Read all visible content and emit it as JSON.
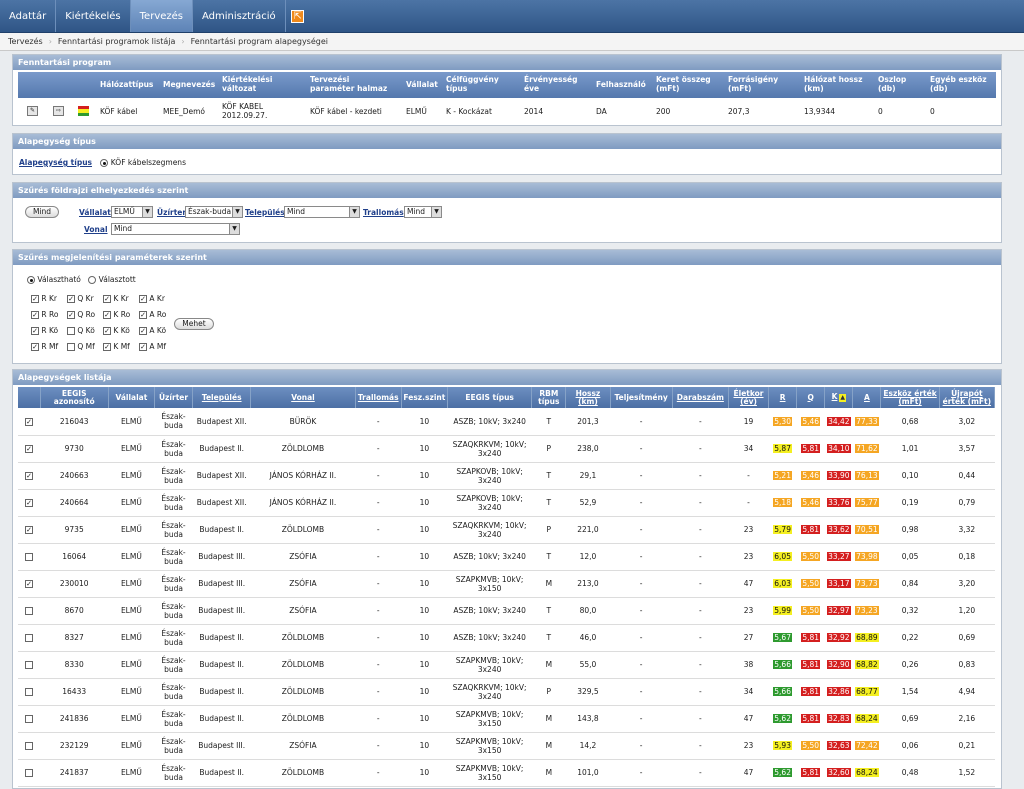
{
  "topnav": {
    "items": [
      {
        "label": "Adattár",
        "active": false
      },
      {
        "label": "Kiértékelés",
        "active": false
      },
      {
        "label": "Tervezés",
        "active": true
      },
      {
        "label": "Adminisztráció",
        "active": false
      }
    ]
  },
  "breadcrumb": [
    "Tervezés",
    "Fenntartási programok listája",
    "Fenntartási program alapegységei"
  ],
  "program": {
    "title": "Fenntartási program",
    "headers": [
      "Hálózattípus",
      "Megnevezés",
      "Kiértékelési változat",
      "Tervezési paraméter halmaz",
      "Vállalat",
      "Célfüggvény típus",
      "Érvényesség éve",
      "Felhasználó",
      "Keret összeg (mFt)",
      "Forrásigény (mFt)",
      "Hálózat hossz (km)",
      "Oszlop (db)",
      "Egyéb eszköz (db)"
    ],
    "values": [
      "KÖF kábel",
      "MEE_Demó",
      "KÖF KABEL 2012.09.27.",
      "KÖF kábel - kezdeti",
      "ELMŰ",
      "K - Kockázat",
      "2014",
      "DA",
      "200",
      "207,3",
      "13,9344",
      "0",
      "0"
    ]
  },
  "unit_type": {
    "title": "Alapegység típus",
    "label": "Alapegység típus",
    "option": "KÖF kábelszegmens"
  },
  "geo_filter": {
    "title": "Szűrés földrajzi elhelyezkedés szerint",
    "all_button": "Mind",
    "company_label": "Vállalat",
    "company_value": "ELMŰ",
    "region_label": "Üzírter",
    "region_value": "Észak-buda",
    "settlement_label": "Település",
    "settlement_value": "Mind",
    "route_label": "Trallomás",
    "route_value": "Mind",
    "line_label": "Vonal",
    "line_value": "Mind"
  },
  "param_filter": {
    "title": "Szűrés megjelenítési paraméterek szerint",
    "radio_selectable": "Választható",
    "radio_selected": "Választott",
    "checkboxes": [
      [
        {
          "label": "R Kr",
          "checked": true
        },
        {
          "label": "Q Kr",
          "checked": true
        },
        {
          "label": "K Kr",
          "checked": true
        },
        {
          "label": "A Kr",
          "checked": true
        }
      ],
      [
        {
          "label": "R Ro",
          "checked": true
        },
        {
          "label": "Q Ro",
          "checked": true
        },
        {
          "label": "K Ro",
          "checked": true
        },
        {
          "label": "A Ro",
          "checked": true
        }
      ],
      [
        {
          "label": "R Kö",
          "checked": true
        },
        {
          "label": "Q Kö",
          "checked": false
        },
        {
          "label": "K Kö",
          "checked": true
        },
        {
          "label": "A Kö",
          "checked": true
        }
      ],
      [
        {
          "label": "R Mf",
          "checked": true
        },
        {
          "label": "Q Mf",
          "checked": false
        },
        {
          "label": "K Mf",
          "checked": true
        },
        {
          "label": "A Mf",
          "checked": true
        }
      ]
    ],
    "go_button": "Mehet"
  },
  "list": {
    "title": "Alapegységek listája",
    "columns": [
      "",
      "EEGIS azonosító",
      "Vállalat",
      "Üzírter",
      "Település",
      "Vonal",
      "Trallomás",
      "Fesz.szint",
      "EEGIS típus",
      "RBM típus",
      "Hossz (km)",
      "Teljesítmény",
      "Darabszám",
      "Életkor (év)",
      "R",
      "Q",
      "K",
      "A",
      "Eszköz érték (mFt)",
      "Újrapót érték (mFt)"
    ],
    "rows": [
      {
        "checked": true,
        "id": "216043",
        "company": "ELMŰ",
        "region": "Észak-buda",
        "settlement": "Budapest XII.",
        "line": "BÜRÖK",
        "station": "-",
        "voltage": "10",
        "type": "ASZB; 10kV; 3x240",
        "rbm": "T",
        "length": "201,3",
        "power": "-",
        "count": "-",
        "age": "19",
        "r": "5,30",
        "rc": "orange",
        "q": "5,46",
        "qc": "orange",
        "k": "34,42",
        "kc": "red",
        "a": "77,33",
        "ac": "orange",
        "asset": "0,68",
        "replace": "3,02"
      },
      {
        "checked": true,
        "id": "9730",
        "company": "ELMŰ",
        "region": "Észak-buda",
        "settlement": "Budapest II.",
        "line": "ZÖLDLOMB",
        "station": "-",
        "voltage": "10",
        "type": "SZAQKRKVM; 10kV; 3x240",
        "rbm": "P",
        "length": "238,0",
        "power": "-",
        "count": "-",
        "age": "34",
        "r": "5,87",
        "rc": "yellow",
        "q": "5,81",
        "qc": "red",
        "k": "34,10",
        "kc": "red",
        "a": "71,62",
        "ac": "orange",
        "asset": "1,01",
        "replace": "3,57"
      },
      {
        "checked": true,
        "id": "240663",
        "company": "ELMŰ",
        "region": "Észak-buda",
        "settlement": "Budapest XII.",
        "line": "JÁNOS KÓRHÁZ II.",
        "station": "-",
        "voltage": "10",
        "type": "SZAPKOVB; 10kV; 3x240",
        "rbm": "T",
        "length": "29,1",
        "power": "-",
        "count": "-",
        "age": "-",
        "r": "5,21",
        "rc": "orange",
        "q": "5,46",
        "qc": "orange",
        "k": "33,90",
        "kc": "red",
        "a": "76,13",
        "ac": "orange",
        "asset": "0,10",
        "replace": "0,44"
      },
      {
        "checked": true,
        "id": "240664",
        "company": "ELMŰ",
        "region": "Észak-buda",
        "settlement": "Budapest XII.",
        "line": "JÁNOS KÓRHÁZ II.",
        "station": "-",
        "voltage": "10",
        "type": "SZAPKOVB; 10kV; 3x240",
        "rbm": "T",
        "length": "52,9",
        "power": "-",
        "count": "-",
        "age": "-",
        "r": "5,18",
        "rc": "orange",
        "q": "5,46",
        "qc": "orange",
        "k": "33,76",
        "kc": "red",
        "a": "75,77",
        "ac": "orange",
        "asset": "0,19",
        "replace": "0,79"
      },
      {
        "checked": true,
        "id": "9735",
        "company": "ELMŰ",
        "region": "Észak-buda",
        "settlement": "Budapest II.",
        "line": "ZÖLDLOMB",
        "station": "-",
        "voltage": "10",
        "type": "SZAQKRKVM; 10kV; 3x240",
        "rbm": "P",
        "length": "221,0",
        "power": "-",
        "count": "-",
        "age": "23",
        "r": "5,79",
        "rc": "yellow",
        "q": "5,81",
        "qc": "red",
        "k": "33,62",
        "kc": "red",
        "a": "70,51",
        "ac": "orange",
        "asset": "0,98",
        "replace": "3,32"
      },
      {
        "checked": false,
        "id": "16064",
        "company": "ELMŰ",
        "region": "Észak-buda",
        "settlement": "Budapest III.",
        "line": "ZSÓFIA",
        "station": "-",
        "voltage": "10",
        "type": "ASZB; 10kV; 3x240",
        "rbm": "T",
        "length": "12,0",
        "power": "-",
        "count": "-",
        "age": "23",
        "r": "6,05",
        "rc": "yellow",
        "q": "5,50",
        "qc": "orange",
        "k": "33,27",
        "kc": "red",
        "a": "73,98",
        "ac": "orange",
        "asset": "0,05",
        "replace": "0,18"
      },
      {
        "checked": true,
        "id": "230010",
        "company": "ELMŰ",
        "region": "Észak-buda",
        "settlement": "Budapest III.",
        "line": "ZSÓFIA",
        "station": "-",
        "voltage": "10",
        "type": "SZAPKMVB; 10kV; 3x150",
        "rbm": "M",
        "length": "213,0",
        "power": "-",
        "count": "-",
        "age": "47",
        "r": "6,03",
        "rc": "yellow",
        "q": "5,50",
        "qc": "orange",
        "k": "33,17",
        "kc": "red",
        "a": "73,73",
        "ac": "orange",
        "asset": "0,84",
        "replace": "3,20"
      },
      {
        "checked": false,
        "id": "8670",
        "company": "ELMŰ",
        "region": "Észak-buda",
        "settlement": "Budapest III.",
        "line": "ZSÓFIA",
        "station": "-",
        "voltage": "10",
        "type": "ASZB; 10kV; 3x240",
        "rbm": "T",
        "length": "80,0",
        "power": "-",
        "count": "-",
        "age": "23",
        "r": "5,99",
        "rc": "yellow",
        "q": "5,50",
        "qc": "orange",
        "k": "32,97",
        "kc": "red",
        "a": "73,23",
        "ac": "orange",
        "asset": "0,32",
        "replace": "1,20"
      },
      {
        "checked": false,
        "id": "8327",
        "company": "ELMŰ",
        "region": "Észak-buda",
        "settlement": "Budapest II.",
        "line": "ZÖLDLOMB",
        "station": "-",
        "voltage": "10",
        "type": "ASZB; 10kV; 3x240",
        "rbm": "T",
        "length": "46,0",
        "power": "-",
        "count": "-",
        "age": "27",
        "r": "5,67",
        "rc": "green",
        "q": "5,81",
        "qc": "red",
        "k": "32,92",
        "kc": "red",
        "a": "68,89",
        "ac": "yellow",
        "asset": "0,22",
        "replace": "0,69"
      },
      {
        "checked": false,
        "id": "8330",
        "company": "ELMŰ",
        "region": "Észak-buda",
        "settlement": "Budapest II.",
        "line": "ZÖLDLOMB",
        "station": "-",
        "voltage": "10",
        "type": "SZAPKMVB; 10kV; 3x240",
        "rbm": "M",
        "length": "55,0",
        "power": "-",
        "count": "-",
        "age": "38",
        "r": "5,66",
        "rc": "green",
        "q": "5,81",
        "qc": "red",
        "k": "32,90",
        "kc": "red",
        "a": "68,82",
        "ac": "yellow",
        "asset": "0,26",
        "replace": "0,83"
      },
      {
        "checked": false,
        "id": "16433",
        "company": "ELMŰ",
        "region": "Észak-buda",
        "settlement": "Budapest II.",
        "line": "ZÖLDLOMB",
        "station": "-",
        "voltage": "10",
        "type": "SZAQKRKVM; 10kV; 3x240",
        "rbm": "P",
        "length": "329,5",
        "power": "-",
        "count": "-",
        "age": "34",
        "r": "5,66",
        "rc": "green",
        "q": "5,81",
        "qc": "red",
        "k": "32,86",
        "kc": "red",
        "a": "68,77",
        "ac": "yellow",
        "asset": "1,54",
        "replace": "4,94"
      },
      {
        "checked": false,
        "id": "241836",
        "company": "ELMŰ",
        "region": "Észak-buda",
        "settlement": "Budapest II.",
        "line": "ZÖLDLOMB",
        "station": "-",
        "voltage": "10",
        "type": "SZAPKMVB; 10kV; 3x150",
        "rbm": "M",
        "length": "143,8",
        "power": "-",
        "count": "-",
        "age": "47",
        "r": "5,62",
        "rc": "green",
        "q": "5,81",
        "qc": "red",
        "k": "32,83",
        "kc": "red",
        "a": "68,24",
        "ac": "yellow",
        "asset": "0,69",
        "replace": "2,16"
      },
      {
        "checked": false,
        "id": "232129",
        "company": "ELMŰ",
        "region": "Észak-buda",
        "settlement": "Budapest III.",
        "line": "ZSÓFIA",
        "station": "-",
        "voltage": "10",
        "type": "SZAPKMVB; 10kV; 3x150",
        "rbm": "M",
        "length": "14,2",
        "power": "-",
        "count": "-",
        "age": "23",
        "r": "5,93",
        "rc": "yellow",
        "q": "5,50",
        "qc": "orange",
        "k": "32,63",
        "kc": "red",
        "a": "72,42",
        "ac": "orange",
        "asset": "0,06",
        "replace": "0,21"
      },
      {
        "checked": false,
        "id": "241837",
        "company": "ELMŰ",
        "region": "Észak-buda",
        "settlement": "Budapest II.",
        "line": "ZÖLDLOMB",
        "station": "-",
        "voltage": "10",
        "type": "SZAPKMVB; 10kV; 3x150",
        "rbm": "M",
        "length": "101,0",
        "power": "-",
        "count": "-",
        "age": "47",
        "r": "5,62",
        "rc": "green",
        "q": "5,81",
        "qc": "red",
        "k": "32,60",
        "kc": "red",
        "a": "68,24",
        "ac": "yellow",
        "asset": "0,48",
        "replace": "1,52"
      }
    ]
  }
}
